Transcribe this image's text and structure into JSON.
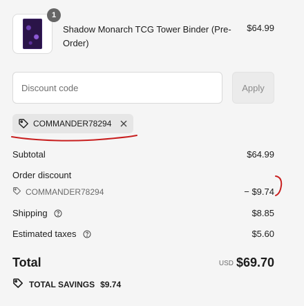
{
  "product": {
    "name": "Shadow Monarch TCG Tower Binder (Pre-Order)",
    "price": "$64.99",
    "quantity": "1"
  },
  "discount": {
    "placeholder": "Discount code",
    "apply_label": "Apply",
    "applied_code": "COMMANDER78294"
  },
  "summary": {
    "subtotal_label": "Subtotal",
    "subtotal_value": "$64.99",
    "order_discount_label": "Order discount",
    "discount_code": "COMMANDER78294",
    "discount_value": "− $9.74",
    "shipping_label": "Shipping",
    "shipping_value": "$8.85",
    "taxes_label": "Estimated taxes",
    "taxes_value": "$5.60",
    "total_label": "Total",
    "currency": "USD",
    "total_value": "$69.70",
    "savings_label": "TOTAL SAVINGS",
    "savings_value": "$9.74"
  },
  "colors": {
    "background": "#f5f5f5",
    "annotation_red": "#c81e1e",
    "badge": "#666666"
  }
}
